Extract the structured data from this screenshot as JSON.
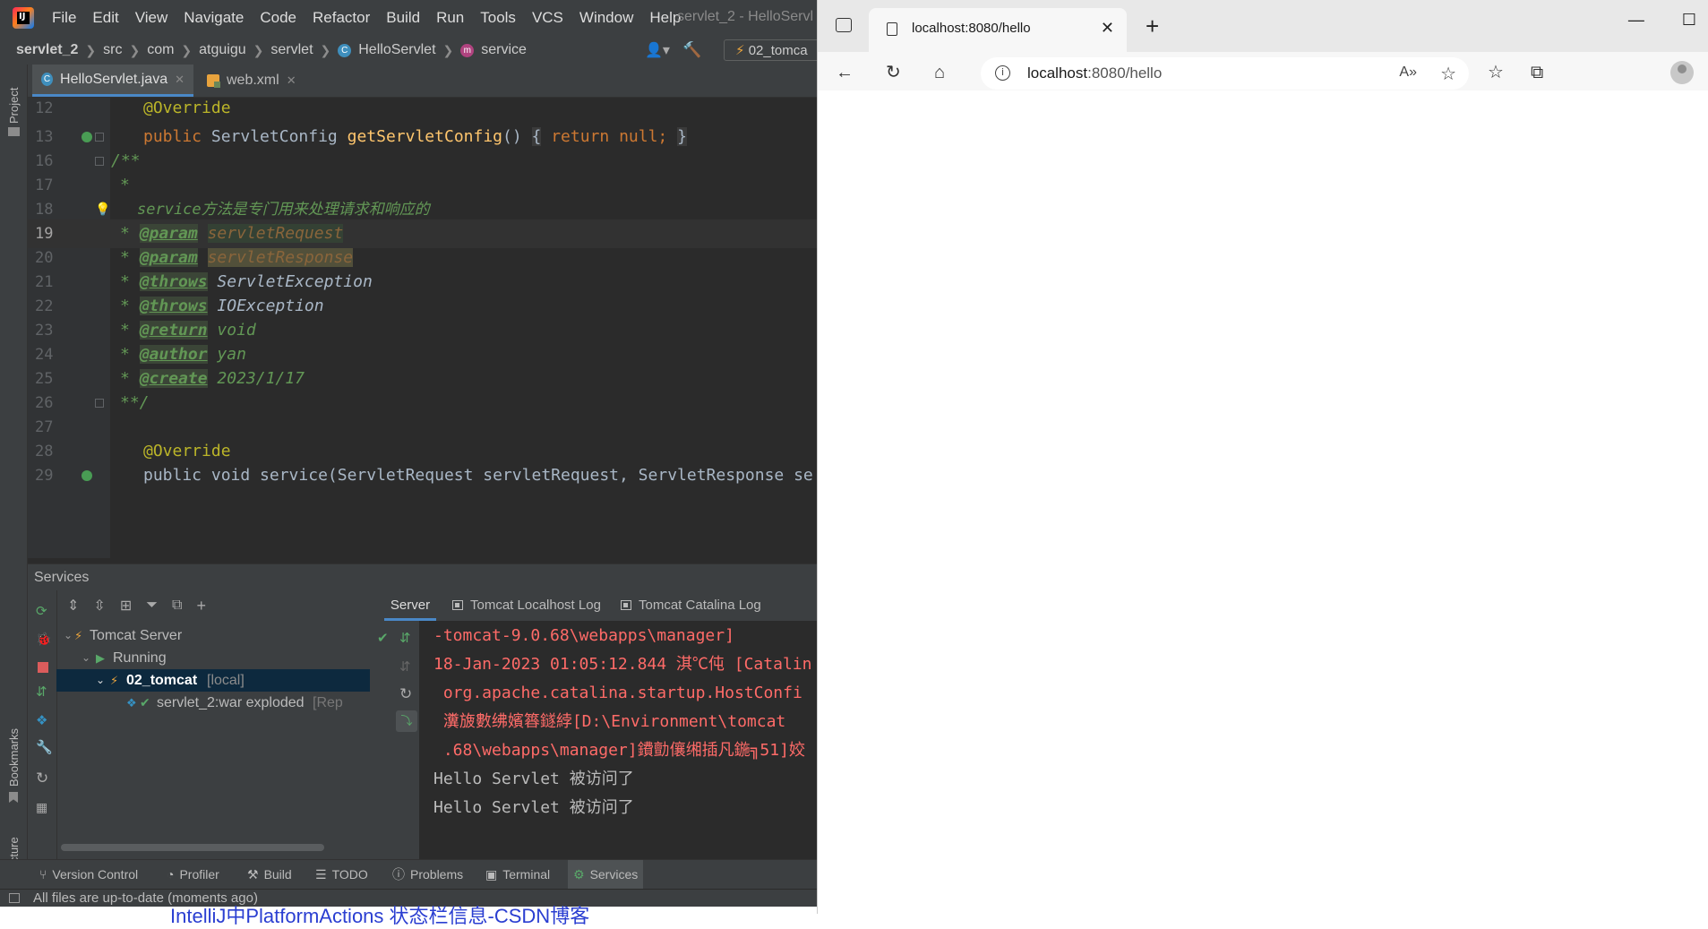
{
  "ide": {
    "logo": "IJ",
    "menu": [
      "File",
      "Edit",
      "View",
      "Navigate",
      "Code",
      "Refactor",
      "Build",
      "Run",
      "Tools",
      "VCS",
      "Window",
      "Help"
    ],
    "window_title": "servlet_2 - HelloServl",
    "breadcrumb": [
      "servlet_2",
      "src",
      "com",
      "atguigu",
      "servlet",
      "HelloServlet",
      "service"
    ],
    "run_config": "02_tomca",
    "side_labels": {
      "project": "Project",
      "bookmarks": "Bookmarks",
      "structure": "Structure"
    },
    "tabs": [
      {
        "label": "HelloServlet.java",
        "active": true
      },
      {
        "label": "web.xml",
        "active": false
      }
    ],
    "editor": {
      "line_numbers": [
        "12",
        "13",
        "16",
        "17",
        "18",
        "19",
        "20",
        "21",
        "22",
        "23",
        "24",
        "25",
        "26",
        "27",
        "28",
        "29"
      ],
      "l12_ann": "@Override",
      "l13_k1": "public",
      "l13_type": "ServletConfig",
      "l13_fn": "getServletConfig",
      "l13_parens": "()",
      "l13_ob": "{",
      "l13_ret": "return null;",
      "l13_cb": "}",
      "l16": "/**",
      "l17": "*",
      "l18": "service方法是专门用来处理请求和响应的",
      "star": "*",
      "tag_param": "@param",
      "tag_throws": "@throws",
      "tag_return": "@return",
      "tag_author": "@author",
      "tag_create": "@create",
      "p_req": "servletRequest",
      "p_resp": "servletResponse",
      "t_servlet_exc": "ServletException",
      "t_io_exc": "IOException",
      "t_void": "void",
      "t_author": "yan",
      "t_create": "2023/1/17",
      "l26": "**/",
      "l28_ann": "@Override",
      "l29": "public void service(ServletRequest servletRequest, ServletResponse se"
    },
    "services": {
      "title": "Services",
      "tree": {
        "tomcat_server": "Tomcat Server",
        "running": "Running",
        "instance": "02_tomcat",
        "instance_tag": "[local]",
        "artifact": "servlet_2:war exploded",
        "artifact_tag": "[Rep"
      },
      "console_tabs": [
        "Server",
        "Tomcat Localhost Log",
        "Tomcat Catalina Log"
      ],
      "console_lines": [
        {
          "text": "-tomcat-9.0.68\\webapps\\manager]",
          "kind": "err"
        },
        {
          "text": "18-Jan-2023 01:05:12.844 淇℃伅 [Catalin",
          "kind": "err"
        },
        {
          "text": " org.apache.catalina.startup.HostConfi",
          "kind": "err"
        },
        {
          "text": " 瀵旇數绋嬪簭鐩綍[D:\\Environment\\tomcat",
          "kind": "err"
        },
        {
          "text": " .68\\webapps\\manager]鐨勯儴缃插凡鍦╗51]姣",
          "kind": "err"
        },
        {
          "text": "Hello Servlet 被访问了",
          "kind": "out"
        },
        {
          "text": "Hello Servlet 被访问了",
          "kind": "out"
        }
      ]
    },
    "bottom_tools": [
      "Version Control",
      "Profiler",
      "Build",
      "TODO",
      "Problems",
      "Terminal",
      "Services"
    ],
    "status": "All files are up-to-date (moments ago)",
    "underlay_text": "IntelliJ中PlatformActions  状态栏信息-CSDN博客"
  },
  "browser": {
    "tab_title": "localhost:8080/hello",
    "url_host": "localhost",
    "url_rest": ":8080/hello"
  },
  "colors": {
    "ide_bg": "#2b2b2b",
    "ide_panel": "#3c3f41",
    "keyword": "#cc7832",
    "annotation": "#bbb529",
    "method": "#ffc66d",
    "doc_comment": "#629755",
    "console_error": "#ff6b68",
    "selection": "#0d293e",
    "browser_chrome": "#e8e8e8"
  }
}
